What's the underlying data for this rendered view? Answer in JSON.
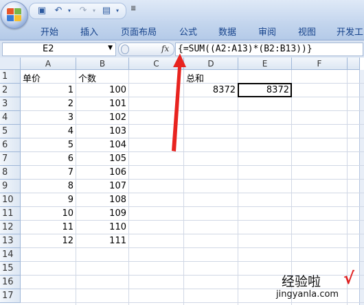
{
  "qat": {
    "more": "≣"
  },
  "ribbon": {
    "tabs": [
      "开始",
      "插入",
      "页面布局",
      "公式",
      "数据",
      "审阅",
      "视图",
      "开发工"
    ]
  },
  "formula_bar": {
    "name_box": "E2",
    "fx_label": "fx",
    "formula": "{=SUM((A2:A13)*(B2:B13))}"
  },
  "sheet": {
    "columns": [
      "A",
      "B",
      "C",
      "D",
      "E",
      "F"
    ],
    "rows": [
      "1",
      "2",
      "3",
      "4",
      "5",
      "6",
      "7",
      "8",
      "9",
      "10",
      "11",
      "12",
      "13",
      "14",
      "15",
      "16",
      "17"
    ],
    "cells": {
      "A1": "单价",
      "B1": "个数",
      "D1": "总和",
      "A2": "1",
      "B2": "100",
      "D2": "8372",
      "E2": "8372",
      "A3": "2",
      "B3": "101",
      "A4": "3",
      "B4": "102",
      "A5": "4",
      "B5": "103",
      "A6": "5",
      "B6": "104",
      "A7": "6",
      "B7": "105",
      "A8": "7",
      "B8": "106",
      "A9": "8",
      "B9": "107",
      "A10": "9",
      "B10": "108",
      "A11": "10",
      "B11": "109",
      "A12": "11",
      "B12": "110",
      "A13": "12",
      "B13": "111"
    },
    "selected_cell": "E2"
  },
  "watermark": {
    "line1": "经验啦",
    "check": "√",
    "line2": "jingyanla.com"
  },
  "colors": {
    "arrow": "#e8231f",
    "ribbon_text": "#15428b",
    "grid_line": "#d0d7e5"
  }
}
